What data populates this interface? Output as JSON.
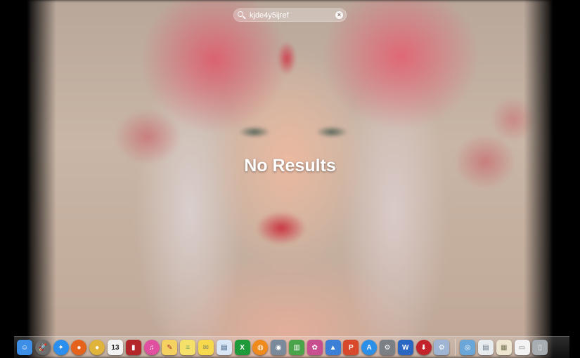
{
  "search": {
    "value": "kjde4y5ijref"
  },
  "message": "No Results",
  "dock": {
    "apps": [
      {
        "name": "finder-icon",
        "glyph": "☺",
        "color": "#3d8ee6"
      },
      {
        "name": "launchpad-icon",
        "glyph": "🚀",
        "color": "#6d6d6d",
        "round": true
      },
      {
        "name": "safari-icon",
        "glyph": "✦",
        "color": "#2b8ff0",
        "round": true
      },
      {
        "name": "firefox-icon",
        "glyph": "●",
        "color": "#e5621d",
        "round": true
      },
      {
        "name": "chrome-icon",
        "glyph": "●",
        "color": "#e0b33a",
        "round": true
      },
      {
        "name": "calendar-icon",
        "glyph": "13",
        "color": "#f2f2f2",
        "text": "#222"
      },
      {
        "name": "photo-booth-icon",
        "glyph": "▮",
        "color": "#b3262a"
      },
      {
        "name": "itunes-icon",
        "glyph": "♫",
        "color": "#e14fa0",
        "round": true
      },
      {
        "name": "textedit-icon",
        "glyph": "✎",
        "color": "#f4d160",
        "text": "#a33"
      },
      {
        "name": "stickies-icon",
        "glyph": "≡",
        "color": "#f5e06a",
        "text": "#7a6"
      },
      {
        "name": "notes-icon",
        "glyph": "✉",
        "color": "#f6d94d",
        "text": "#886"
      },
      {
        "name": "preview-icon",
        "glyph": "▤",
        "color": "#d9e6f5",
        "text": "#357"
      },
      {
        "name": "excel-icon",
        "glyph": "X",
        "color": "#1f9a3b"
      },
      {
        "name": "ibooks-icon",
        "glyph": "◍",
        "color": "#f08a1c",
        "round": true
      },
      {
        "name": "image-capture-icon",
        "glyph": "◉",
        "color": "#7a8a9a"
      },
      {
        "name": "numbers-icon",
        "glyph": "▥",
        "color": "#4aa54a"
      },
      {
        "name": "photo-app-icon",
        "glyph": "✿",
        "color": "#c84f8f"
      },
      {
        "name": "keynote-icon",
        "glyph": "▲",
        "color": "#3b7fd6"
      },
      {
        "name": "powerpoint-icon",
        "glyph": "P",
        "color": "#d8482a"
      },
      {
        "name": "app-store-icon",
        "glyph": "A",
        "color": "#2c90e8",
        "round": true
      },
      {
        "name": "system-preferences-icon",
        "glyph": "⚙",
        "color": "#7b7f86"
      },
      {
        "name": "word-icon",
        "glyph": "W",
        "color": "#2a67c2"
      },
      {
        "name": "downloader-icon",
        "glyph": "⬇",
        "color": "#c3232a",
        "round": true
      },
      {
        "name": "utility-icon",
        "glyph": "⚙",
        "color": "#9fb5d3"
      }
    ],
    "folders": [
      {
        "name": "applications-folder-icon",
        "glyph": "◎",
        "color": "#6aa6d8"
      },
      {
        "name": "documents-stack-icon",
        "glyph": "▤",
        "color": "#e9ecef",
        "text": "#678"
      },
      {
        "name": "downloads-stack-icon",
        "glyph": "▦",
        "color": "#efe6d2",
        "text": "#775"
      },
      {
        "name": "file-stack-icon",
        "glyph": "▭",
        "color": "#f3f3f3",
        "text": "#888"
      },
      {
        "name": "trash-icon",
        "glyph": "▯",
        "color": "#a8adb3",
        "text": "#eee"
      }
    ]
  }
}
